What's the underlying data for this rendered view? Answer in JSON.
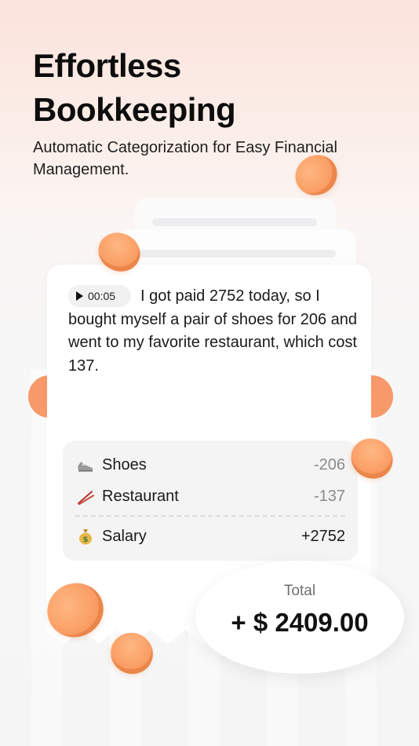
{
  "hero": {
    "title_line1": "Effortless",
    "title_line2": "Bookkeeping",
    "subtitle": "Automatic Categorization for Easy Financial Management."
  },
  "message": {
    "voice_duration": "00:05",
    "text": "I got paid 2752 today, so I bought myself a pair of shoes for 206 and went to my favorite restaurant, which cost 137."
  },
  "transactions": [
    {
      "icon": "shoe-icon",
      "label": "Shoes",
      "amount": "-206"
    },
    {
      "icon": "chopsticks-icon",
      "label": "Restaurant",
      "amount": "-137"
    },
    {
      "icon": "money-bag-icon",
      "label": "Salary",
      "amount": "+2752"
    }
  ],
  "total": {
    "label": "Total",
    "value": "+ $ 2409.00"
  },
  "colors": {
    "accent": "#f7996a",
    "coin": "#fa9f66",
    "background_top": "#fbe3dc",
    "background": "#f5f5f5"
  }
}
